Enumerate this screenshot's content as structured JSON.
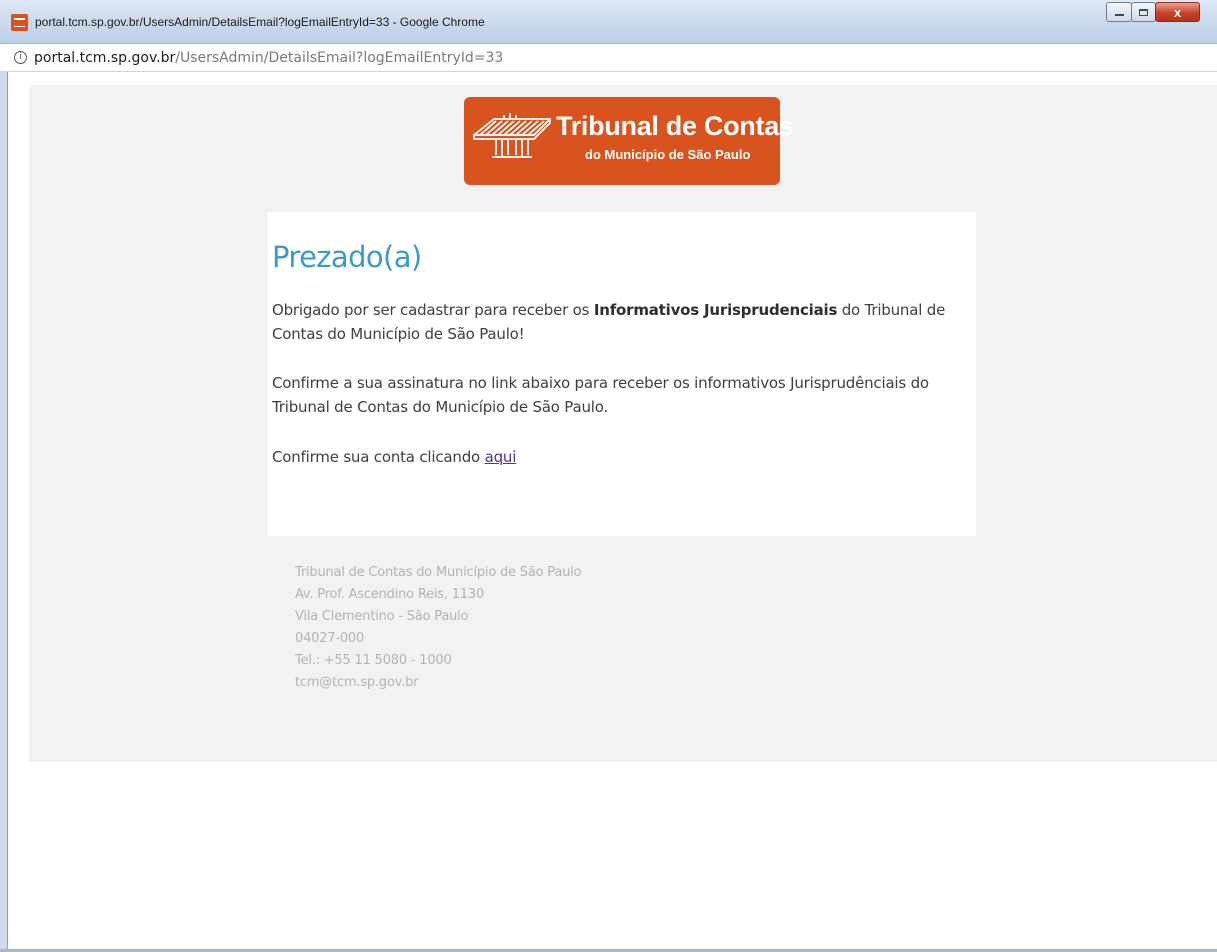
{
  "window": {
    "title": "portal.tcm.sp.gov.br/UsersAdmin/DetailsEmail?logEmailEntryId=33 - Google Chrome",
    "close_label": "x"
  },
  "address_bar": {
    "host": "portal.tcm.sp.gov.br",
    "path": "/UsersAdmin/DetailsEmail?logEmailEntryId=33"
  },
  "email": {
    "logo": {
      "title": "Tribunal de Contas",
      "subtitle": "do Município de São Paulo"
    },
    "greeting": "Prezado(a)",
    "paragraph1": {
      "before": "Obrigado por ser cadastrar para receber os ",
      "bold": "Informativos Jurisprudenciais",
      "after": " do Tribunal de Contas do Município de São Paulo!"
    },
    "paragraph2": "Confirme a sua assinatura no link abaixo para receber os informativos Jurisprudênciais do Tribunal de Contas do Município de São Paulo.",
    "paragraph3": {
      "before": "Confirme sua conta clicando ",
      "link": "aqui"
    },
    "footer": {
      "org": "Tribunal de Contas do Município de São Paulo",
      "street": "Av. Prof. Ascendino Reis, 1130",
      "district": "Vila Clementino - São Paulo",
      "zip": "04027-000",
      "phone": "Tel.: +55 11 5080 - 1000",
      "email": "tcm@tcm.sp.gov.br"
    }
  },
  "colors": {
    "brand_orange": "#d9531e",
    "heading_blue": "#3a9cc4",
    "link_purple": "#5b2f8f"
  }
}
